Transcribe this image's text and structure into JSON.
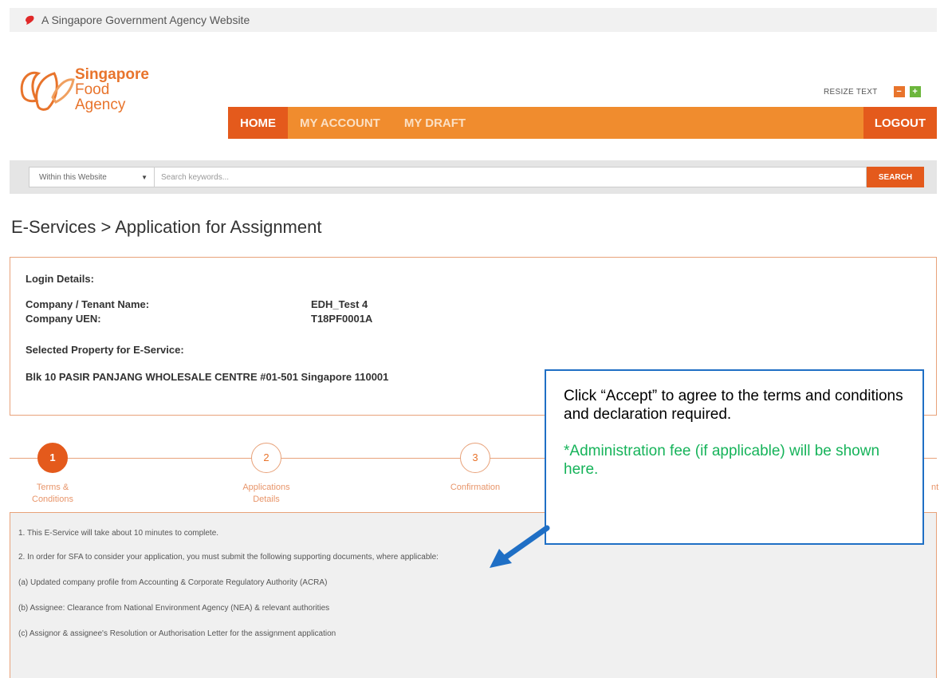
{
  "gov_banner": {
    "text": "A Singapore Government Agency Website"
  },
  "logo": {
    "line1": "Singapore",
    "line2": "Food",
    "line3": "Agency"
  },
  "resize": {
    "label": "RESIZE TEXT",
    "minus": "−",
    "plus": "+"
  },
  "nav": {
    "home": "HOME",
    "my_account": "MY ACCOUNT",
    "my_draft": "MY DRAFT",
    "logout": "LOGOUT"
  },
  "search": {
    "scope": "Within this Website",
    "placeholder": "Search keywords...",
    "button": "SEARCH"
  },
  "page_title": "E-Services > Application for Assignment",
  "login": {
    "heading": "Login Details:",
    "company_label": "Company / Tenant Name:",
    "company_value": "EDH_Test 4",
    "uen_label": "Company UEN:",
    "uen_value": "T18PF0001A",
    "property_heading": "Selected Property for E-Service:",
    "property_value": "Blk 10 PASIR PANJANG WHOLESALE CENTRE #01-501 Singapore 110001"
  },
  "steps": [
    {
      "number": "1",
      "label": "Terms &",
      "label2": "Conditions"
    },
    {
      "number": "2",
      "label": "Applications",
      "label2": "Details"
    },
    {
      "number": "3",
      "label": "Confirmation",
      "label2": ""
    },
    {
      "number": "",
      "label": "nt",
      "label2": ""
    }
  ],
  "terms": [
    "1. This E-Service will take about 10 minutes to complete.",
    "2. In order for SFA to consider your application, you must submit the following supporting documents, where applicable:",
    "(a) Updated company profile from Accounting & Corporate Regulatory Authority (ACRA)",
    "(b) Assignee: Clearance from National Environment Agency (NEA) & relevant authorities",
    "(c) Assignor & assignee's Resolution or Authorisation Letter for the assignment application"
  ],
  "callout": {
    "message": "Click “Accept” to agree to the terms and conditions and declaration required.",
    "fee_note": " *Administration fee (if applicable) will be shown here."
  },
  "colors": {
    "nav_orange": "#f08c2e",
    "nav_active": "#e45a1c",
    "callout_border": "#1f6fc5",
    "fee_green": "#16b35a"
  }
}
